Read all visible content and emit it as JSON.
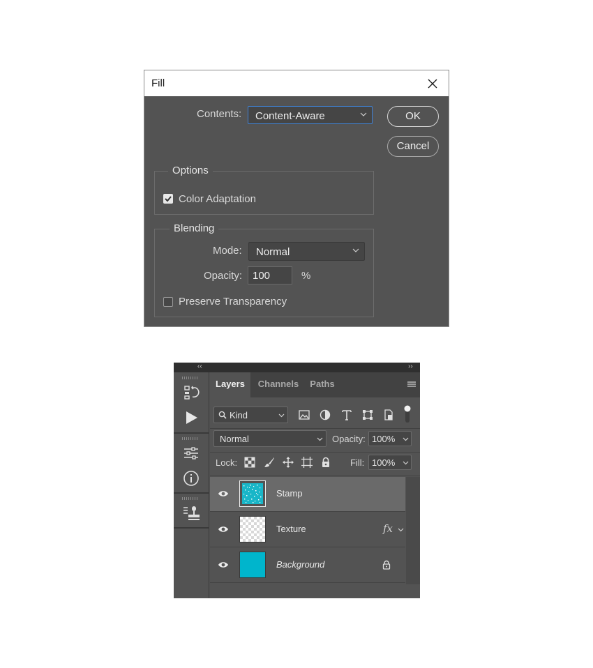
{
  "fill_dialog": {
    "title": "Fill",
    "contents_label": "Contents:",
    "contents_value": "Content-Aware",
    "ok_label": "OK",
    "cancel_label": "Cancel",
    "options": {
      "legend": "Options",
      "color_adaptation_label": "Color Adaptation",
      "color_adaptation_checked": true
    },
    "blending": {
      "legend": "Blending",
      "mode_label": "Mode:",
      "mode_value": "Normal",
      "opacity_label": "Opacity:",
      "opacity_value": "100",
      "opacity_unit": "%",
      "preserve_transparency_label": "Preserve Transparency",
      "preserve_transparency_checked": false
    }
  },
  "layers_panel": {
    "collapse_left": "‹‹",
    "collapse_right": "››",
    "tabs": [
      {
        "label": "Layers",
        "active": true
      },
      {
        "label": "Channels",
        "active": false
      },
      {
        "label": "Paths",
        "active": false
      }
    ],
    "filter_kind": "Kind",
    "blend_mode": "Normal",
    "opacity_label": "Opacity:",
    "opacity_value": "100%",
    "lock_label": "Lock:",
    "fill_label": "Fill:",
    "fill_value": "100%",
    "layers": [
      {
        "name": "Stamp",
        "selected": true,
        "visible": true,
        "thumb": "teal-speckle"
      },
      {
        "name": "Texture",
        "selected": false,
        "visible": true,
        "thumb": "transparent",
        "fx": "fx"
      },
      {
        "name": "Background",
        "selected": false,
        "visible": true,
        "thumb": "solid-teal",
        "locked": true
      }
    ],
    "colors": {
      "accent_teal": "#00b5cc",
      "panel_bg": "#535353",
      "selected_row": "#6a6a6a"
    }
  }
}
